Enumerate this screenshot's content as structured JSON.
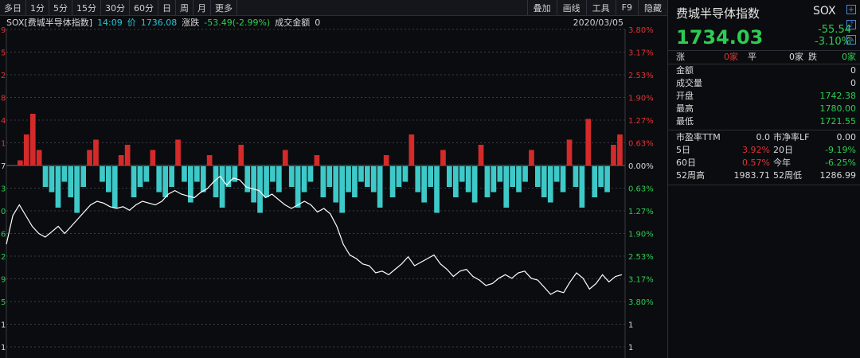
{
  "toolbar": {
    "left": [
      "多日",
      "1分",
      "5分",
      "15分",
      "30分",
      "60分",
      "日",
      "周",
      "月",
      "更多"
    ],
    "right": [
      "叠加",
      "画线",
      "工具",
      "F9",
      "隐藏"
    ]
  },
  "info": {
    "name": "SOX[费城半导体指数]",
    "time": "14:09",
    "price_label": "价",
    "price": "1736.08",
    "change_label": "涨跌",
    "change": "-53.49(-2.99%)",
    "amount_label": "成交金额",
    "amount": "0",
    "date": "2020/03/05"
  },
  "chart_data": {
    "type": "line",
    "left_ticks": [
      "9",
      "5",
      "2",
      "8",
      "4",
      "1",
      "7",
      "3",
      "0",
      "6",
      "2",
      "9",
      "5",
      "1",
      "1"
    ],
    "right_ticks": [
      "3.80%",
      "3.17%",
      "2.53%",
      "1.90%",
      "1.27%",
      "0.63%",
      "0.00%",
      "0.63%",
      "1.27%",
      "1.90%",
      "2.53%",
      "3.17%",
      "3.80%",
      "1",
      "1"
    ],
    "right_tick_colors": [
      "#e03333",
      "#e03333",
      "#e03333",
      "#e03333",
      "#e03333",
      "#e03333",
      "#d9d9d9",
      "#2ecc52",
      "#2ecc52",
      "#2ecc52",
      "#2ecc52",
      "#2ecc52",
      "#2ecc52",
      "#d9d9d9",
      "#d9d9d9"
    ],
    "ylim_pct": [
      -3.8,
      3.8
    ],
    "line_pct": [
      -2.2,
      -1.4,
      -1.1,
      -1.4,
      -1.7,
      -1.9,
      -2.0,
      -1.85,
      -1.7,
      -1.9,
      -1.7,
      -1.5,
      -1.3,
      -1.1,
      -1.0,
      -1.05,
      -1.15,
      -1.2,
      -1.15,
      -1.25,
      -1.1,
      -1.0,
      -1.05,
      -1.1,
      -1.0,
      -0.8,
      -0.7,
      -0.8,
      -0.85,
      -0.9,
      -0.75,
      -0.65,
      -0.45,
      -0.3,
      -0.55,
      -0.35,
      -0.4,
      -0.6,
      -0.65,
      -0.7,
      -0.9,
      -0.8,
      -0.95,
      -1.1,
      -1.2,
      -1.1,
      -1.0,
      -1.1,
      -1.3,
      -1.2,
      -1.35,
      -1.7,
      -2.2,
      -2.5,
      -2.6,
      -2.75,
      -2.8,
      -3.0,
      -2.95,
      -3.05,
      -2.9,
      -2.75,
      -2.55,
      -2.8,
      -2.7,
      -2.6,
      -2.5,
      -2.75,
      -2.9,
      -3.1,
      -2.95,
      -2.9,
      -3.1,
      -3.2,
      -3.35,
      -3.3,
      -3.15,
      -3.05,
      -3.15,
      -3.0,
      -2.95,
      -3.15,
      -3.2,
      -3.4,
      -3.6,
      -3.5,
      -3.55,
      -3.25,
      -3.0,
      -3.15,
      -3.45,
      -3.3,
      -3.05,
      -3.25,
      -3.1,
      -3.05
    ],
    "volume": [
      0.1,
      0.6,
      1.0,
      0.3,
      -0.4,
      -0.5,
      -0.8,
      -0.3,
      -0.6,
      -0.9,
      -0.4,
      0.3,
      0.5,
      -0.3,
      -0.5,
      -0.8,
      0.2,
      0.4,
      -0.6,
      -0.4,
      -0.3,
      0.3,
      -0.5,
      -0.6,
      -0.4,
      0.5,
      -0.3,
      -0.7,
      -0.3,
      -0.5,
      0.2,
      -0.6,
      -0.8,
      -0.4,
      -0.3,
      0.4,
      -0.5,
      -0.7,
      -0.9,
      -0.6,
      -0.3,
      -0.5,
      0.3,
      -0.4,
      -0.8,
      -0.5,
      -0.3,
      0.2,
      -0.6,
      -0.4,
      -0.7,
      -0.9,
      -0.5,
      -0.6,
      -0.3,
      -0.4,
      -0.5,
      -0.8,
      0.2,
      -0.6,
      -0.4,
      -0.3,
      0.6,
      -0.5,
      -0.7,
      -0.4,
      -0.9,
      0.3,
      -0.4,
      -0.6,
      -0.3,
      -0.5,
      -0.7,
      0.4,
      -0.6,
      -0.5,
      -0.3,
      -0.8,
      -0.4,
      -0.5,
      -0.3,
      0.3,
      -0.4,
      -0.6,
      -0.7,
      -0.3,
      -0.5,
      0.5,
      -0.4,
      -0.8,
      0.9,
      -0.6,
      -0.4,
      -0.5,
      0.4,
      0.6
    ]
  },
  "panel": {
    "title": "费城半导体指数",
    "code": "SOX",
    "icons": [
      "plus-icon",
      "bell-icon",
      "edit-icon"
    ],
    "price": "1734.03",
    "change": "-55.54",
    "change_pct": "-3.10%",
    "breadth": {
      "up_label": "涨",
      "up": "0家",
      "flat_label": "平",
      "flat": "0家",
      "down_label": "跌",
      "down": "0家"
    },
    "stats": [
      {
        "label": "金额",
        "value": "0"
      },
      {
        "label": "成交量",
        "value": "0"
      },
      {
        "label": "开盘",
        "value": "1742.38"
      },
      {
        "label": "最高",
        "value": "1780.00"
      },
      {
        "label": "最低",
        "value": "1721.55"
      }
    ],
    "pairs": [
      {
        "l1": "市盈率TTM",
        "v1": "0.0",
        "l2": "市净率LF",
        "v2": "0.00"
      },
      {
        "l1": "5日",
        "v1": "3.92%",
        "l2": "20日",
        "v2": "-9.19%"
      },
      {
        "l1": "60日",
        "v1": "0.57%",
        "l2": "今年",
        "v2": "-6.25%"
      },
      {
        "l1": "52周高",
        "v1": "1983.71",
        "l2": "52周低",
        "v2": "1286.99"
      }
    ],
    "colors": {
      "up": "#e03333",
      "down": "#2ecc52",
      "accent": "#27c8d6"
    }
  }
}
